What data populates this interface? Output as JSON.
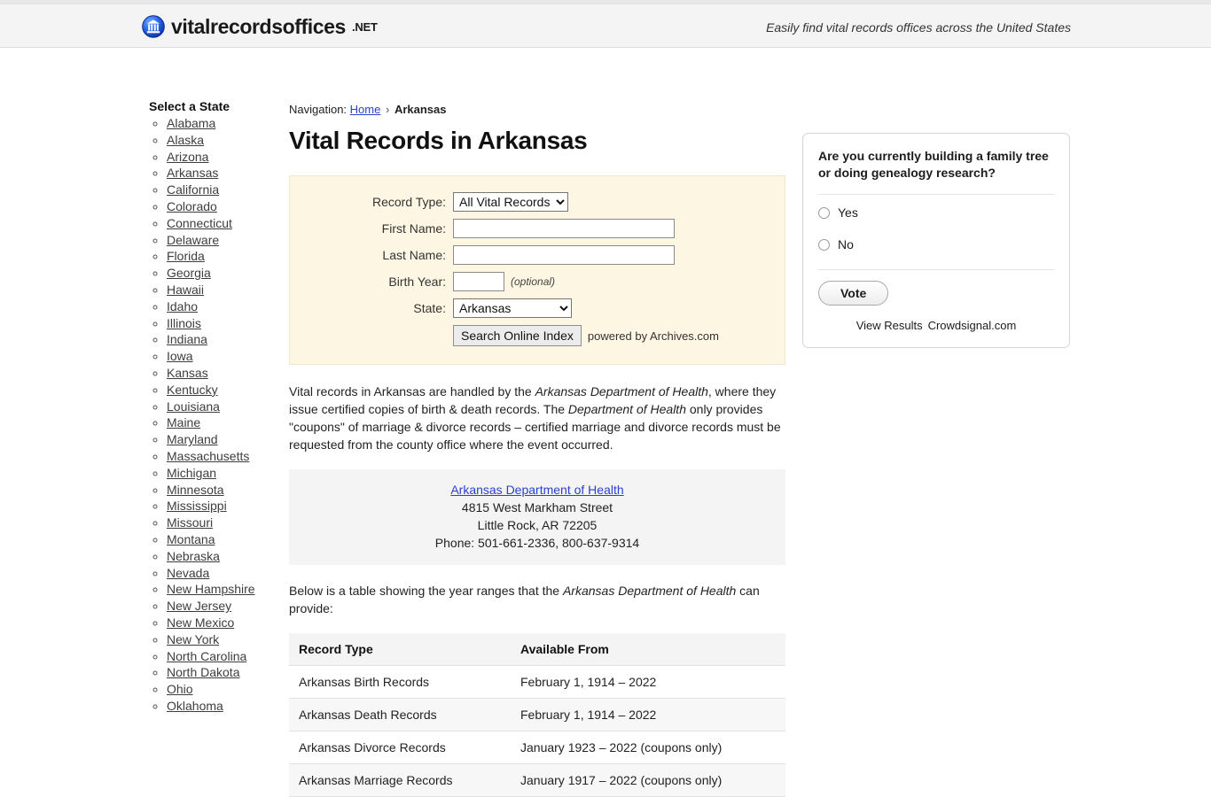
{
  "header": {
    "brand_name": "vitalrecordsoffices",
    "brand_tld": ".NET",
    "tagline": "Easily find vital records offices across the United States",
    "logo_icon": "bank-building-icon"
  },
  "sidebar": {
    "heading": "Select a State",
    "states": [
      "Alabama",
      "Alaska",
      "Arizona",
      "Arkansas",
      "California",
      "Colorado",
      "Connecticut",
      "Delaware",
      "Florida",
      "Georgia",
      "Hawaii",
      "Idaho",
      "Illinois",
      "Indiana",
      "Iowa",
      "Kansas",
      "Kentucky",
      "Louisiana",
      "Maine",
      "Maryland",
      "Massachusetts",
      "Michigan",
      "Minnesota",
      "Mississippi",
      "Missouri",
      "Montana",
      "Nebraska",
      "Nevada",
      "New Hampshire",
      "New Jersey",
      "New Mexico",
      "New York",
      "North Carolina",
      "North Dakota",
      "Ohio",
      "Oklahoma"
    ]
  },
  "breadcrumb": {
    "prefix": "Navigation:",
    "home_label": "Home",
    "separator": "›",
    "current": "Arkansas"
  },
  "main": {
    "page_title": "Vital Records in Arkansas",
    "intro_paragraph": {
      "part1": "Vital records in Arkansas are handled by the ",
      "em1": "Arkansas Department of Health",
      "part2": ", where they issue certified copies of birth & death records. The ",
      "em2": "Department of Health",
      "part3": " only provides \"coupons\" of marriage & divorce records – certified marriage and divorce records must be requested from the county office where the event occurred."
    },
    "table_intro": {
      "part1": "Below is a table showing the year ranges that the ",
      "em1": "Arkansas Department of Health",
      "part2": " can provide:"
    }
  },
  "search_form": {
    "record_type_label": "Record Type:",
    "record_type_value": "All Vital Records",
    "record_type_options": [
      "All Vital Records"
    ],
    "first_name_label": "First Name:",
    "first_name_value": "",
    "last_name_label": "Last Name:",
    "last_name_value": "",
    "birth_year_label": "Birth Year:",
    "birth_year_value": "",
    "birth_year_note": "(optional)",
    "state_label": "State:",
    "state_value": "Arkansas",
    "state_options": [
      "Arkansas"
    ],
    "submit_label": "Search Online Index",
    "powered_by": "powered by Archives.com"
  },
  "agency": {
    "name": "Arkansas Department of Health",
    "street": "4815 West Markham Street",
    "city_state_zip": "Little Rock, AR 72205",
    "phone": "Phone: 501-661-2336, 800-637-9314"
  },
  "records_table": {
    "columns": [
      "Record Type",
      "Available From"
    ],
    "rows": [
      {
        "type": "Arkansas Birth Records",
        "available": "February 1, 1914 – 2022"
      },
      {
        "type": "Arkansas Death Records",
        "available": "February 1, 1914 – 2022"
      },
      {
        "type": "Arkansas Divorce Records",
        "available": "January 1923 – 2022 (coupons only)"
      },
      {
        "type": "Arkansas Marriage Records",
        "available": "January 1917 – 2022 (coupons only)"
      }
    ]
  },
  "poll": {
    "question": "Are you currently building a family tree or doing genealogy research?",
    "options": [
      "Yes",
      "No"
    ],
    "vote_label": "Vote",
    "view_results_label": "View Results",
    "provider_label": "Crowdsignal.com"
  },
  "colors": {
    "header_bg": "#f4f4f4",
    "form_bg": "#fdf6e3",
    "link": "#2b3fcf",
    "address_bg": "#f4f4f4",
    "table_header_bg": "#f4f4f4",
    "table_stripe_bg": "#f7f7f7",
    "brand_blue": "#1b4fd8"
  }
}
